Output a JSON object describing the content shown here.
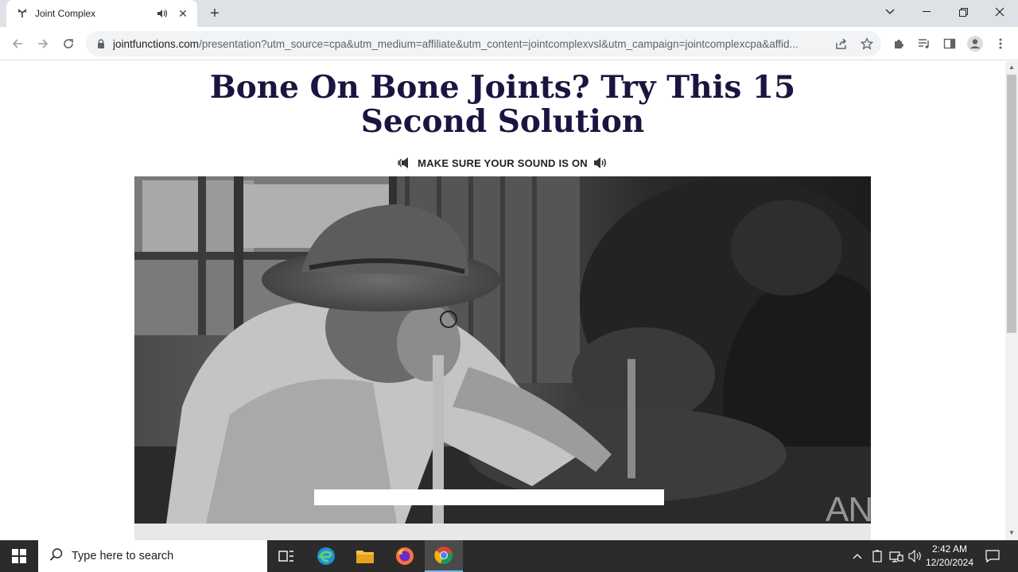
{
  "browser": {
    "tab_title": "Joint Complex",
    "url_host": "jointfunctions.com",
    "url_rest": "/presentation?utm_source=cpa&utm_medium=affiliate&utm_content=jointcomplexvsl&utm_campaign=jointcomplexcpa&affid...",
    "new_tab_symbol": "+",
    "close_symbol": "✕"
  },
  "page": {
    "headline": "Bone On Bone Joints? Try This 15 Second Solution",
    "sound_note": "MAKE SURE YOUR SOUND IS ON",
    "watermark": "ANY RUN"
  },
  "taskbar": {
    "search_placeholder": "Type here to search",
    "time": "2:42 AM",
    "date": "12/20/2024"
  },
  "colors": {
    "headline": "#1c1440",
    "taskbar": "#2b2b2b",
    "chrome_frame": "#dee1e6"
  },
  "icons": [
    "favicon-icon",
    "audio-icon",
    "close-icon",
    "plus-icon",
    "back-icon",
    "forward-icon",
    "reload-icon",
    "lock-icon",
    "share-icon",
    "star-icon",
    "extensions-icon",
    "media-icon",
    "sidebar-icon",
    "profile-icon",
    "menu-icon",
    "speaker-icon",
    "windows-icon",
    "search-icon",
    "task-view-icon",
    "edge-icon",
    "file-explorer-icon",
    "firefox-icon",
    "chrome-icon",
    "chevron-up-icon",
    "network-icon",
    "volume-icon",
    "notification-icon"
  ]
}
